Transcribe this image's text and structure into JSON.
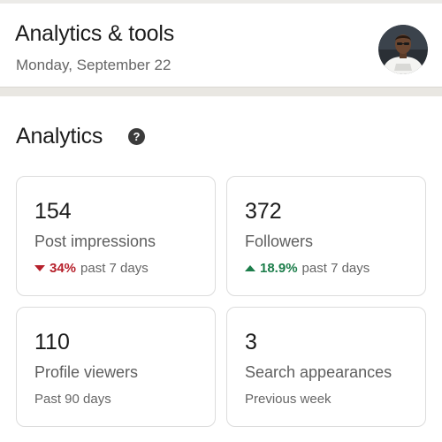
{
  "header": {
    "title": "Analytics & tools",
    "date": "Monday, September 22"
  },
  "analytics": {
    "title": "Analytics",
    "help_icon_glyph": "?",
    "cards": [
      {
        "value": "154",
        "label": "Post impressions",
        "trend": "down",
        "percent": "34%",
        "period": "past 7 days"
      },
      {
        "value": "372",
        "label": "Followers",
        "trend": "up",
        "percent": "18.9%",
        "period": "past 7 days"
      },
      {
        "value": "110",
        "label": "Profile viewers",
        "sub": "Past 90 days"
      },
      {
        "value": "3",
        "label": "Search appearances",
        "sub": "Previous week"
      }
    ]
  },
  "colors": {
    "negative": "#b6202b",
    "positive": "#1c7d4a",
    "divider": "#e9e7e2"
  },
  "icons": {
    "help": "help-circle-icon",
    "trend_down": "caret-down-icon",
    "trend_up": "caret-up-icon"
  }
}
